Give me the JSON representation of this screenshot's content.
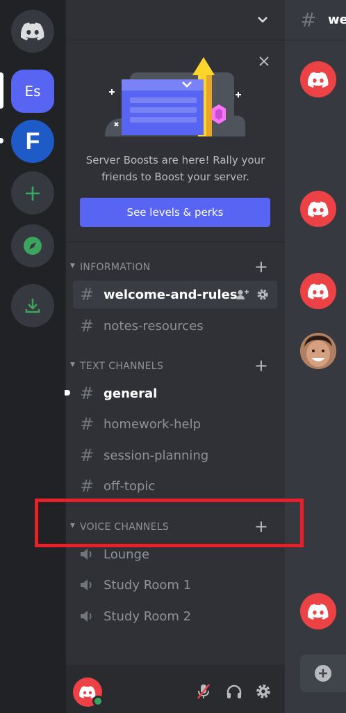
{
  "rail": {
    "servers": [
      {
        "name": "discord-home",
        "label": ""
      },
      {
        "name": "es-server",
        "label": "Es"
      },
      {
        "name": "fortnite-server",
        "label": "F"
      }
    ]
  },
  "boost_banner": {
    "text": "Server Boosts are here! Rally your friends to Boost your server.",
    "button_label": "See levels & perks"
  },
  "categories": {
    "information": "INFORMATION",
    "text": "TEXT CHANNELS",
    "voice": "VOICE CHANNELS"
  },
  "channels": {
    "information": [
      "welcome-and-rules",
      "notes-resources"
    ],
    "text": [
      "general",
      "homework-help",
      "session-planning",
      "off-topic"
    ],
    "voice": [
      "Lounge",
      "Study Room 1",
      "Study Room 2"
    ]
  },
  "header": {
    "channel_name": "we"
  },
  "colors": {
    "blurple": "#5865f2",
    "red": "#ed4245",
    "green": "#3ba55d",
    "highlight": "#e8202a"
  }
}
